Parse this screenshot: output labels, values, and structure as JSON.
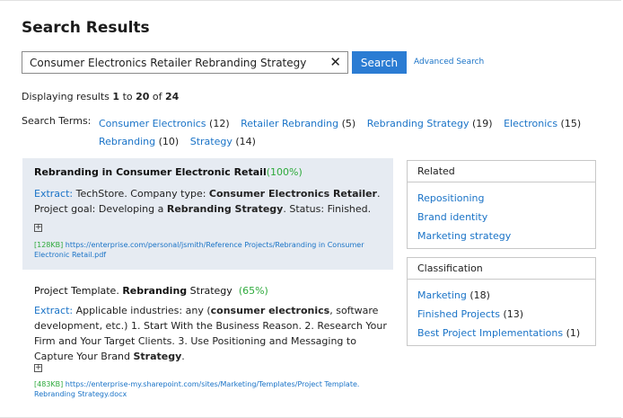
{
  "page_title": "Search Results",
  "search": {
    "query": "Consumer Electronics Retailer Rebranding Strategy",
    "clear_label": "✕",
    "button_label": "Search",
    "advanced_label": "Advanced Search"
  },
  "count": {
    "prefix": "Displaying results",
    "start": "1",
    "to": "to",
    "end": "20",
    "of": "of",
    "total": "24"
  },
  "terms": {
    "label": "Search Terms:",
    "items": [
      {
        "label": "Consumer Electronics",
        "count": "(12)"
      },
      {
        "label": "Retailer Rebranding",
        "count": "(5)"
      },
      {
        "label": "Rebranding Strategy",
        "count": "(19)"
      },
      {
        "label": "Electronics",
        "count": "(15)"
      },
      {
        "label": "Rebranding",
        "count": "(10)"
      },
      {
        "label": "Strategy",
        "count": "(14)"
      }
    ]
  },
  "results": [
    {
      "title_bold": "Rebranding in Consumer Electronic Retail",
      "percent": "(100%)",
      "extract_label": "Extract:",
      "extract_parts": [
        " TechStore. Company type: ",
        "Consumer Electronics Retailer",
        ". Project goal: Developing a ",
        "Rebranding Strategy",
        ". Status: Finished."
      ],
      "expand_label": "+",
      "size": "[128KB]",
      "url": " https://enterprise.com/personal/jsmith/Reference Projects/Rebranding in Consumer Electronic Retail.pdf"
    },
    {
      "title_pre": "Project Template. ",
      "title_bold": "Rebranding",
      "title_post": " Strategy",
      "percent": "(65%)",
      "extract_label": "Extract:",
      "extract_parts": [
        " Applicable industries: any (",
        "consumer electronics",
        ", software development, etc.) 1. Start With the Business Reason. 2. Research Your Firm and Your Target Clients. 3. Use Positioning and Messaging to Capture Your Brand ",
        "Strategy",
        "."
      ],
      "expand_label": "+",
      "size": "[483KB]",
      "url": " https://enterprise-my.sharepoint.com/sites/Marketing/Templates/Project Template. Rebranding Strategy.docx"
    }
  ],
  "related": {
    "header": "Related",
    "items": [
      "Repositioning",
      "Brand identity",
      "Marketing strategy"
    ]
  },
  "classification": {
    "header": "Classification",
    "items": [
      {
        "label": "Marketing",
        "count": "(18)"
      },
      {
        "label": "Finished Projects",
        "count": "(13)"
      },
      {
        "label": "Best Project Implementations",
        "count": "(1)"
      }
    ]
  },
  "colors": {
    "accent": "#2b7cd3",
    "link": "#1a73c7",
    "match_percent": "#2eaa3c",
    "highlight_bg": "#e6ebf2"
  }
}
